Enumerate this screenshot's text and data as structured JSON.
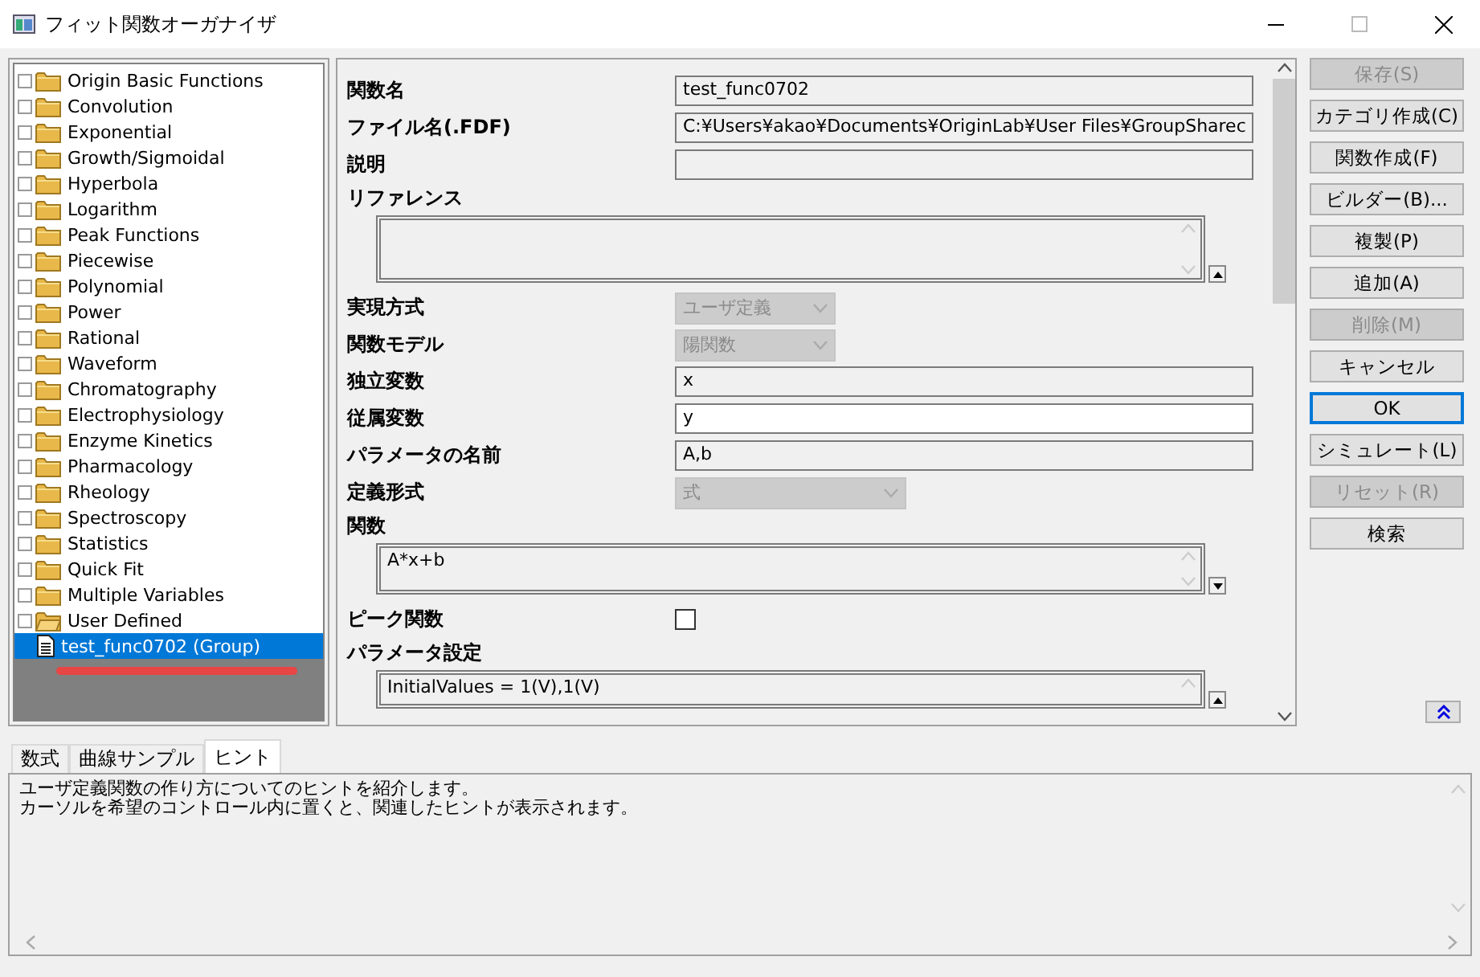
{
  "window": {
    "title": "フィット関数オーガナイザ"
  },
  "tree": {
    "items": [
      {
        "label": "Origin Basic Functions",
        "kind": "folder",
        "expanded": false,
        "selected": false
      },
      {
        "label": "Convolution",
        "kind": "folder",
        "expanded": false,
        "selected": false
      },
      {
        "label": "Exponential",
        "kind": "folder",
        "expanded": false,
        "selected": false
      },
      {
        "label": "Growth/Sigmoidal",
        "kind": "folder",
        "expanded": false,
        "selected": false
      },
      {
        "label": "Hyperbola",
        "kind": "folder",
        "expanded": false,
        "selected": false
      },
      {
        "label": "Logarithm",
        "kind": "folder",
        "expanded": false,
        "selected": false
      },
      {
        "label": "Peak Functions",
        "kind": "folder",
        "expanded": false,
        "selected": false
      },
      {
        "label": "Piecewise",
        "kind": "folder",
        "expanded": false,
        "selected": false
      },
      {
        "label": "Polynomial",
        "kind": "folder",
        "expanded": false,
        "selected": false
      },
      {
        "label": "Power",
        "kind": "folder",
        "expanded": false,
        "selected": false
      },
      {
        "label": "Rational",
        "kind": "folder",
        "expanded": false,
        "selected": false
      },
      {
        "label": "Waveform",
        "kind": "folder",
        "expanded": false,
        "selected": false
      },
      {
        "label": "Chromatography",
        "kind": "folder",
        "expanded": false,
        "selected": false
      },
      {
        "label": "Electrophysiology",
        "kind": "folder",
        "expanded": false,
        "selected": false
      },
      {
        "label": "Enzyme Kinetics",
        "kind": "folder",
        "expanded": false,
        "selected": false
      },
      {
        "label": "Pharmacology",
        "kind": "folder",
        "expanded": false,
        "selected": false
      },
      {
        "label": "Rheology",
        "kind": "folder",
        "expanded": false,
        "selected": false
      },
      {
        "label": "Spectroscopy",
        "kind": "folder",
        "expanded": false,
        "selected": false
      },
      {
        "label": "Statistics",
        "kind": "folder",
        "expanded": false,
        "selected": false
      },
      {
        "label": "Quick Fit",
        "kind": "folder",
        "expanded": false,
        "selected": false
      },
      {
        "label": "Multiple Variables",
        "kind": "folder",
        "expanded": false,
        "selected": false
      },
      {
        "label": "User Defined",
        "kind": "folder",
        "expanded": true,
        "selected": false,
        "children": [
          {
            "label": "test_func0702 (Group)",
            "kind": "file",
            "selected": true
          }
        ]
      }
    ]
  },
  "form": {
    "fields": [
      {
        "label": "関数名",
        "kind": "text",
        "value": "test_func0702",
        "readonly": true
      },
      {
        "label": "ファイル名(.FDF)",
        "kind": "text",
        "value": "C:¥Users¥akao¥Documents¥OriginLab¥User Files¥GroupSharec",
        "readonly": true
      },
      {
        "label": "説明",
        "kind": "text",
        "readonly": true
      },
      {
        "label": "リファレンス",
        "kind": "textarea",
        "readonly": true
      },
      {
        "label": "実現方式",
        "kind": "dropdown",
        "value": "ユーザ定義",
        "disabled": true
      },
      {
        "label": "関数モデル",
        "kind": "dropdown",
        "value": "陽関数",
        "disabled": true
      },
      {
        "label": "独立変数",
        "kind": "text",
        "value": "x",
        "readonly": true
      },
      {
        "label": "従属変数",
        "kind": "text",
        "value": "y",
        "readonly": false
      },
      {
        "label": "パラメータの名前",
        "kind": "text",
        "value": "A,b",
        "readonly": true
      },
      {
        "label": "定義形式",
        "kind": "dropdown",
        "value": "式",
        "disabled": true
      },
      {
        "label": "関数",
        "kind": "textarea",
        "value": "A*x+b",
        "readonly": true
      },
      {
        "label": "ピーク関数",
        "kind": "checkbox",
        "checked": false
      },
      {
        "label": "パラメータ設定",
        "kind": "textarea",
        "value": "InitialValues = 1(V),1(V)",
        "readonly": true
      }
    ]
  },
  "buttons": [
    {
      "label": "保存(S)",
      "disabled": true,
      "focused": false
    },
    {
      "label": "カテゴリ作成(C)",
      "disabled": false,
      "focused": false
    },
    {
      "label": "関数作成(F)",
      "disabled": false,
      "focused": false
    },
    {
      "label": "ビルダー(B)...",
      "disabled": false,
      "focused": false
    },
    {
      "label": "複製(P)",
      "disabled": false,
      "focused": false
    },
    {
      "label": "追加(A)",
      "disabled": false,
      "focused": false
    },
    {
      "label": "削除(M)",
      "disabled": true,
      "focused": false
    },
    {
      "label": "キャンセル",
      "disabled": false,
      "focused": false
    },
    {
      "label": "OK",
      "disabled": false,
      "focused": true
    },
    {
      "label": "シミュレート(L)",
      "disabled": false,
      "focused": false
    },
    {
      "label": "リセット(R)",
      "disabled": true,
      "focused": false
    },
    {
      "label": "検索",
      "disabled": false,
      "focused": false
    }
  ],
  "tabs": [
    {
      "label": "数式",
      "selected": false
    },
    {
      "label": "曲線サンプル",
      "selected": false
    },
    {
      "label": "ヒント",
      "selected": true
    }
  ],
  "hint": {
    "lines": [
      "ユーザ定義関数の作り方についてのヒントを紹介します。",
      "カーソルを希望のコントロール内に置くと、関連したヒントが表示されます。"
    ]
  }
}
